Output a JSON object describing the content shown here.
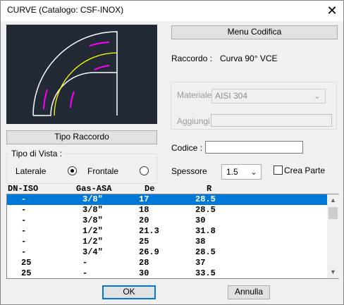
{
  "window": {
    "title": "CURVE (Catalogo: CSF-INOX)"
  },
  "preview": {
    "accent_colors": {
      "outline": "#ffffff",
      "centerline": "#ffff00",
      "marks": "#ff00ff"
    }
  },
  "buttons": {
    "tipo_raccordo": "Tipo Raccordo",
    "menu_codifica": "Menu Codifica",
    "ok": "OK",
    "annulla": "Annulla"
  },
  "raccordo": {
    "label": "Raccordo :",
    "value": "Curva 90°  VCE"
  },
  "materiale": {
    "label": "Materiale",
    "value": "AISI 304"
  },
  "aggiungi": {
    "label": "Aggiungi",
    "value": ""
  },
  "codice": {
    "label": "Codice :",
    "value": ""
  },
  "vista": {
    "legend": "Tipo di Vista :",
    "laterale": "Laterale",
    "frontale": "Frontale",
    "selected": "Laterale"
  },
  "spessore": {
    "label": "Spessore",
    "value": "1.5"
  },
  "crea_parte": {
    "label": "Crea Parte",
    "checked": false
  },
  "table": {
    "headers": [
      "DN-ISO",
      "Gas-ASA",
      "De",
      "R"
    ],
    "rows": [
      [
        "-",
        "3/8\"",
        "17",
        "28.5"
      ],
      [
        "-",
        "3/8\"",
        "18",
        "28.5"
      ],
      [
        "-",
        "3/8\"",
        "20",
        "30"
      ],
      [
        "-",
        "1/2\"",
        "21.3",
        "31.8"
      ],
      [
        "-",
        "1/2\"",
        "25",
        "38"
      ],
      [
        "-",
        "3/4\"",
        "26.9",
        "28.5"
      ],
      [
        "25",
        "-",
        "28",
        "37"
      ],
      [
        "25",
        "-",
        "30",
        "33.5"
      ]
    ],
    "selected_row": 0
  }
}
